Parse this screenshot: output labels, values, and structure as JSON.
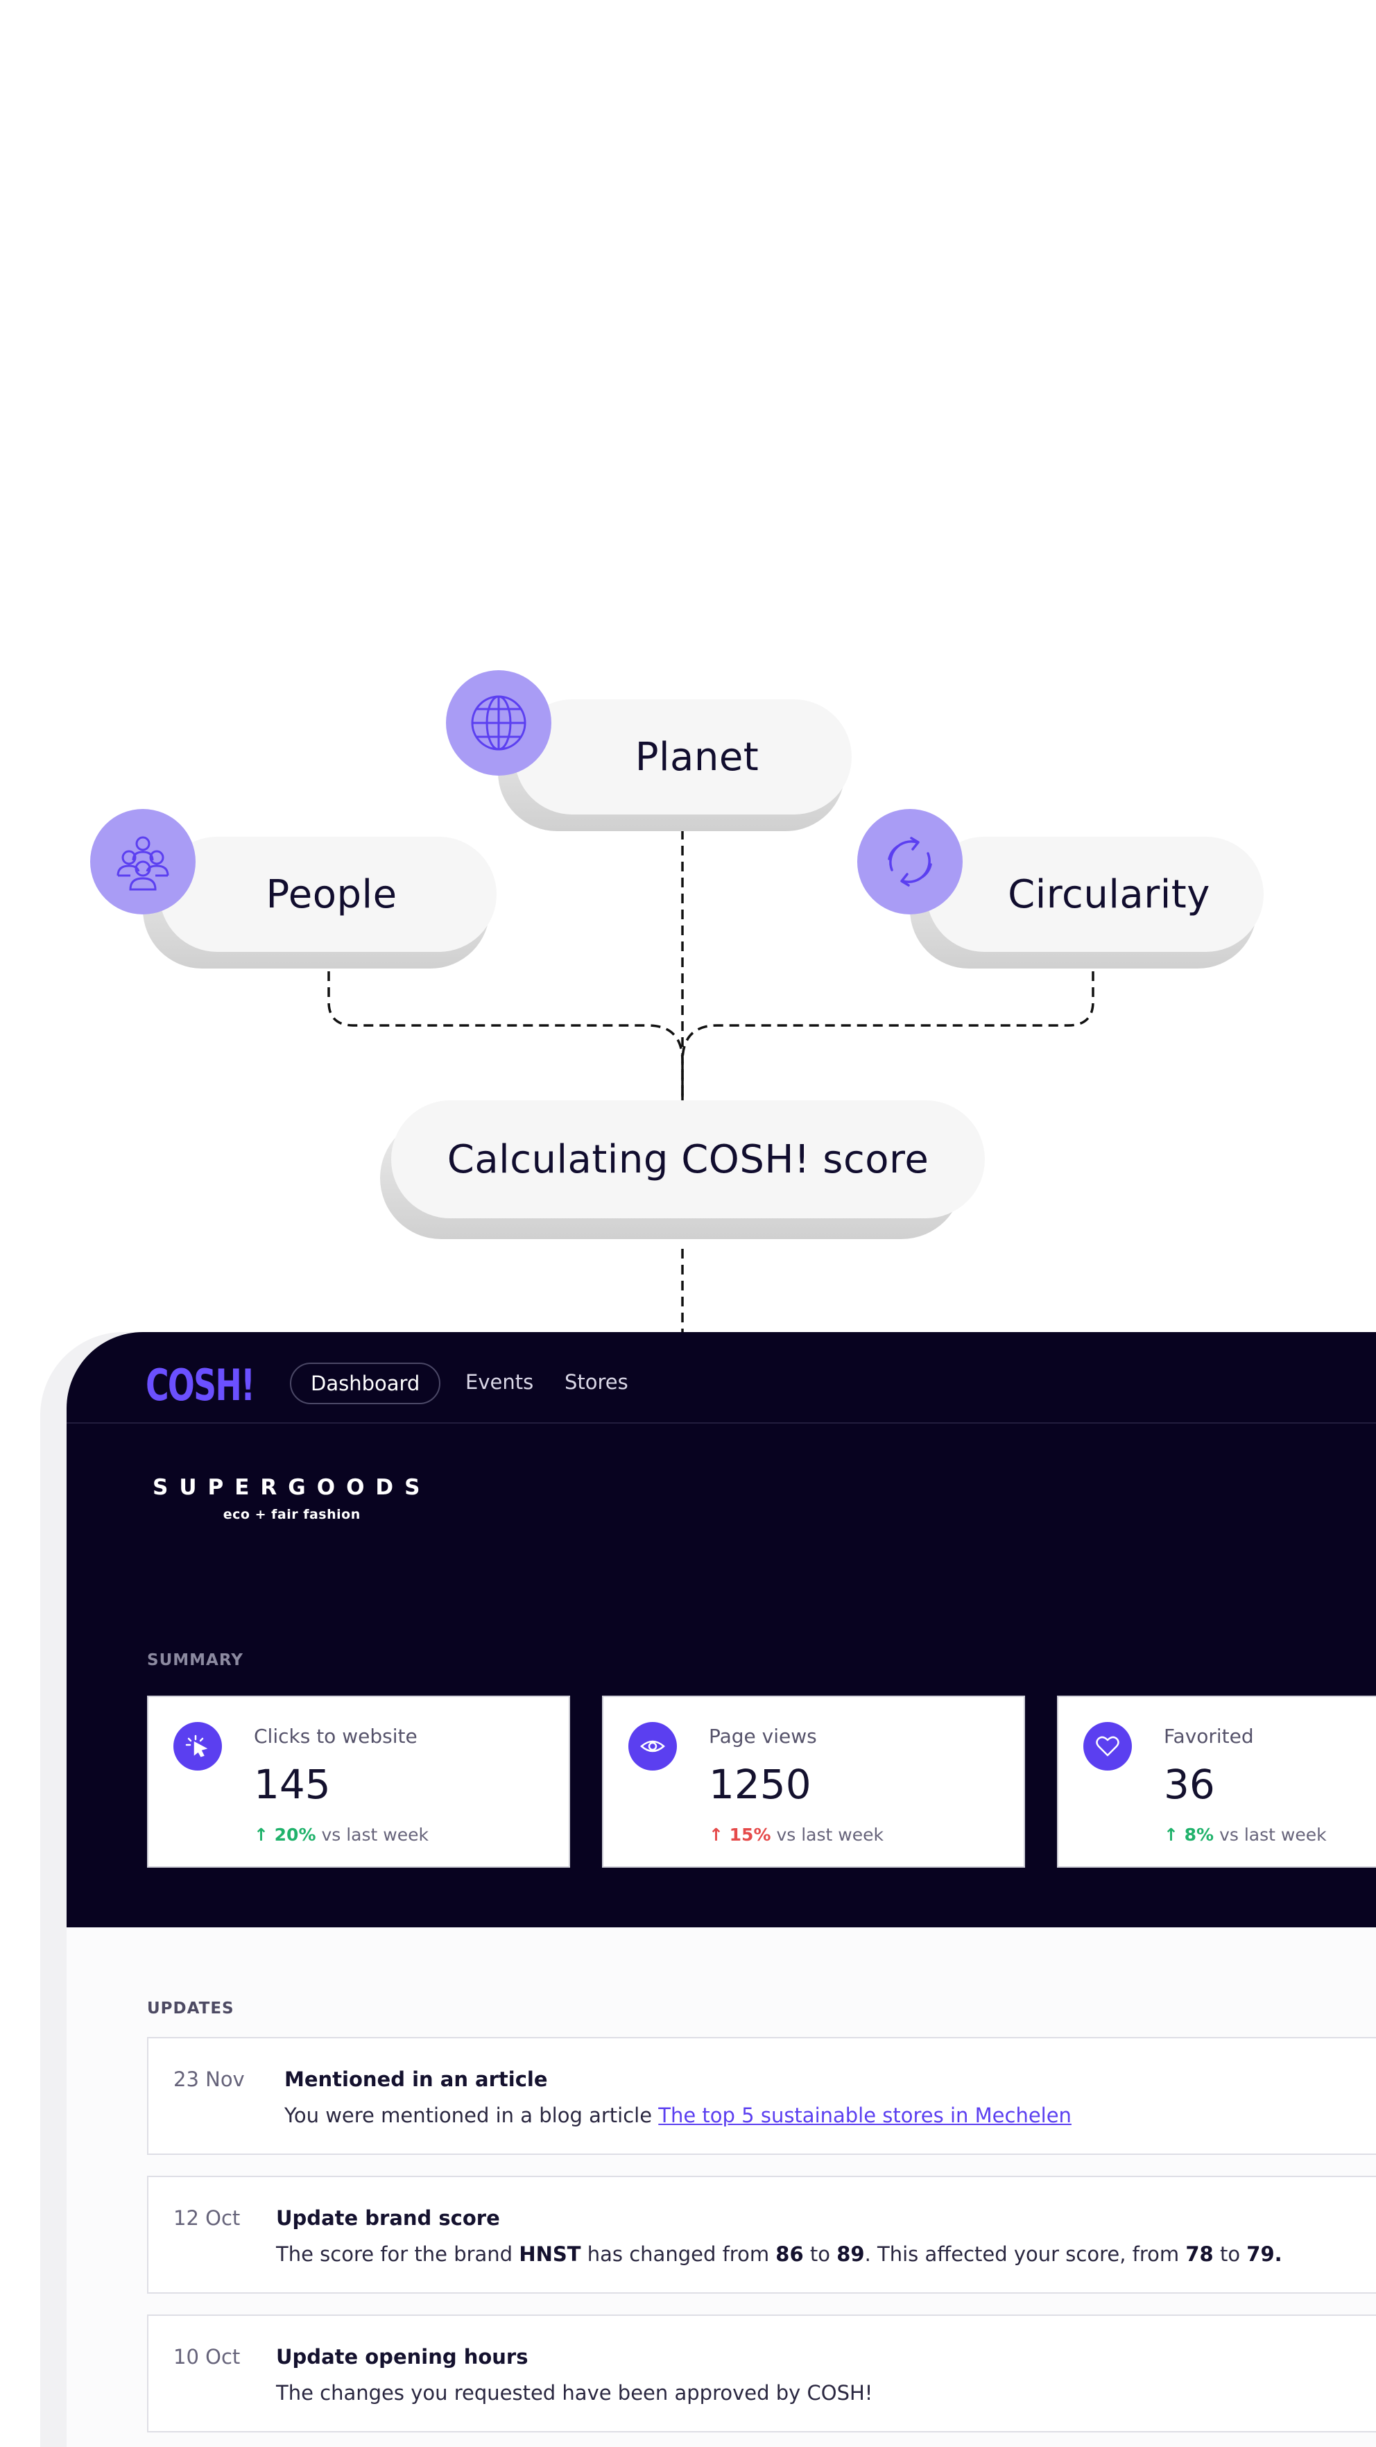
{
  "diagram": {
    "nodes": {
      "planet": {
        "label": "Planet",
        "icon": "globe-icon"
      },
      "people": {
        "label": "People",
        "icon": "people-group-icon"
      },
      "circularity": {
        "label": "Circularity",
        "icon": "recycle-arrows-icon"
      },
      "score": {
        "label": "Calculating COSH! score"
      }
    },
    "icon_bg_color": "#a99cf5",
    "icon_stroke_color": "#5b3ff0"
  },
  "dashboard": {
    "logo": "COSH!",
    "nav": [
      "Dashboard",
      "Events",
      "Stores"
    ],
    "active_nav": "Dashboard",
    "brand": {
      "name": "SUPERGOODS",
      "tagline": "eco + fair fashion"
    },
    "summary": {
      "label": "SUMMARY",
      "cards": [
        {
          "label": "Clicks to website",
          "value": "145",
          "trend": "20%",
          "trend_text": "vs last week",
          "icon": "cursor-click-icon",
          "trend_color": "#20b26b"
        },
        {
          "label": "Page views",
          "value": "1250",
          "trend": "15%",
          "trend_text": "vs last week",
          "icon": "eye-icon",
          "trend_color": "#e54a4a"
        },
        {
          "label": "Favorited",
          "value": "36",
          "trend": "8%",
          "trend_text": "vs last week",
          "icon": "heart-icon",
          "trend_color": "#20b26b"
        }
      ]
    },
    "updates": {
      "label": "UPDATES",
      "items": [
        {
          "date": "23 Nov",
          "title": "Mentioned in an article",
          "text_before": "You were mentioned in a blog article ",
          "link": "The top 5 sustainable stores in Mechelen"
        },
        {
          "date": "12 Oct",
          "title": "Update brand score",
          "parts": [
            "The score for the brand ",
            "HNST",
            " has changed from ",
            "86",
            " to ",
            "89",
            ". This affected your score, from ",
            "78",
            " to ",
            "79."
          ]
        },
        {
          "date": "10 Oct",
          "title": "Update opening hours",
          "text": "The changes you requested have been approved by COSH!"
        }
      ]
    },
    "colors": {
      "dark_bg": "#080320",
      "accent": "#5b3ff0",
      "logo": "#6b50ff"
    }
  }
}
